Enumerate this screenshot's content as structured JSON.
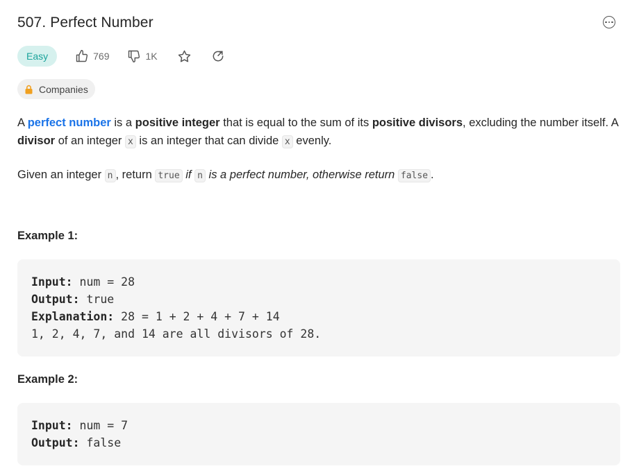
{
  "problem": {
    "title": "507. Perfect Number",
    "difficulty": "Easy",
    "likes": "769",
    "dislikes": "1K",
    "companies_label": "Companies"
  },
  "description": {
    "p1": {
      "t1": "A ",
      "link": "perfect number",
      "t2": " is a ",
      "b1": "positive integer",
      "t3": " that is equal to the sum of its ",
      "b2": "positive divisors",
      "t4": ", excluding the number itself. A ",
      "b3": "divisor",
      "t5": " of an integer ",
      "c1": "x",
      "t6": " is an integer that can divide ",
      "c2": "x",
      "t7": " evenly."
    },
    "p2": {
      "t1": "Given an integer ",
      "c1": "n",
      "t2": ", return ",
      "c2": "true",
      "t3": " ",
      "i1": "if ",
      "c3": "n",
      "i2": " is a perfect number, otherwise return ",
      "c4": "false",
      "t4": "."
    }
  },
  "examples": [
    {
      "title": "Example 1:",
      "input_label": "Input:",
      "input_value": " num = 28",
      "output_label": "Output:",
      "output_value": " true",
      "explanation_label": "Explanation:",
      "explanation_value": " 28 = 1 + 2 + 4 + 7 + 14",
      "explanation_line2": "1, 2, 4, 7, and 14 are all divisors of 28."
    },
    {
      "title": "Example 2:",
      "input_label": "Input:",
      "input_value": " num = 7",
      "output_label": "Output:",
      "output_value": " false"
    }
  ]
}
